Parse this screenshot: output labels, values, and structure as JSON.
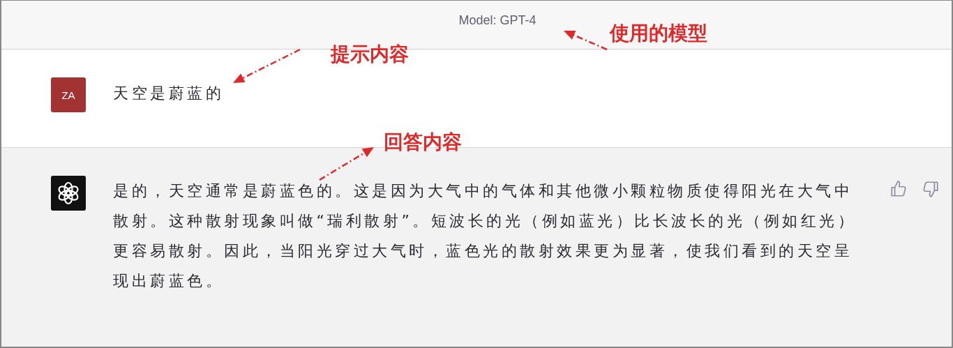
{
  "header": {
    "model_label": "Model: GPT-4"
  },
  "messages": [
    {
      "kind": "user",
      "avatar": "ZA",
      "text": "天空是蔚蓝的"
    },
    {
      "kind": "assistant",
      "text": "是的，天空通常是蔚蓝色的。这是因为大气中的气体和其他微小颗粒物质使得阳光在大气中散射。这种散射现象叫做“瑞利散射”。短波长的光（例如蓝光）比长波长的光（例如红光）更容易散射。因此，当阳光穿过大气时，蓝色光的散射效果更为显著，使我们看到的天空呈现出蔚蓝色。"
    }
  ],
  "annotations": [
    {
      "text": "使用的模型"
    },
    {
      "text": "提示内容"
    },
    {
      "text": "回答内容"
    }
  ]
}
